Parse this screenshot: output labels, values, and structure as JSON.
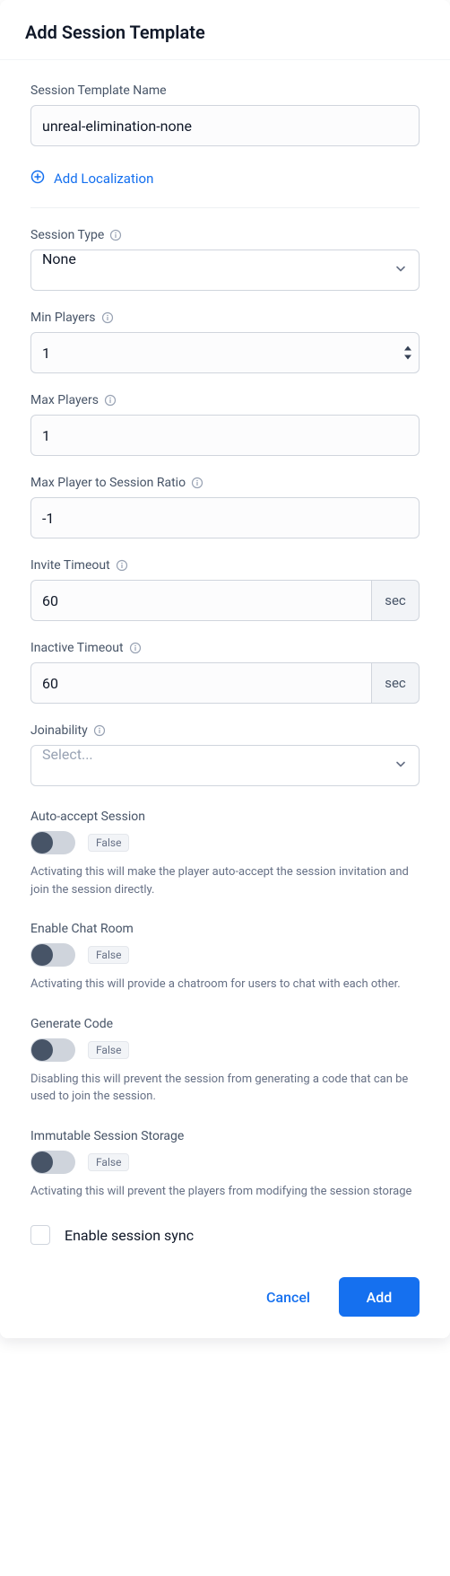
{
  "header": {
    "title": "Add Session Template"
  },
  "name": {
    "label": "Session Template Name",
    "value": "unreal-elimination-none"
  },
  "addLocalization": "Add Localization",
  "sessionType": {
    "label": "Session Type",
    "value": "None"
  },
  "minPlayers": {
    "label": "Min Players",
    "value": "1"
  },
  "maxPlayers": {
    "label": "Max Players",
    "value": "1"
  },
  "maxRatio": {
    "label": "Max Player to Session Ratio",
    "value": "-1"
  },
  "inviteTimeout": {
    "label": "Invite Timeout",
    "value": "60",
    "unit": "sec"
  },
  "inactiveTimeout": {
    "label": "Inactive Timeout",
    "value": "60",
    "unit": "sec"
  },
  "joinability": {
    "label": "Joinability",
    "placeholder": "Select..."
  },
  "toggles": {
    "autoAccept": {
      "label": "Auto-accept Session",
      "badge": "False",
      "help": "Activating this will make the player auto-accept the session invitation and join the session directly."
    },
    "chatRoom": {
      "label": "Enable Chat Room",
      "badge": "False",
      "help": "Activating this will provide a chatroom for users to chat with each other."
    },
    "generateCode": {
      "label": "Generate Code",
      "badge": "False",
      "help": "Disabling this will prevent the session from generating a code that can be used to join the session."
    },
    "immutableStorage": {
      "label": "Immutable Session Storage",
      "badge": "False",
      "help": "Activating this will prevent the players from modifying the session storage"
    }
  },
  "sessionSync": {
    "label": "Enable session sync"
  },
  "footer": {
    "cancel": "Cancel",
    "add": "Add"
  }
}
